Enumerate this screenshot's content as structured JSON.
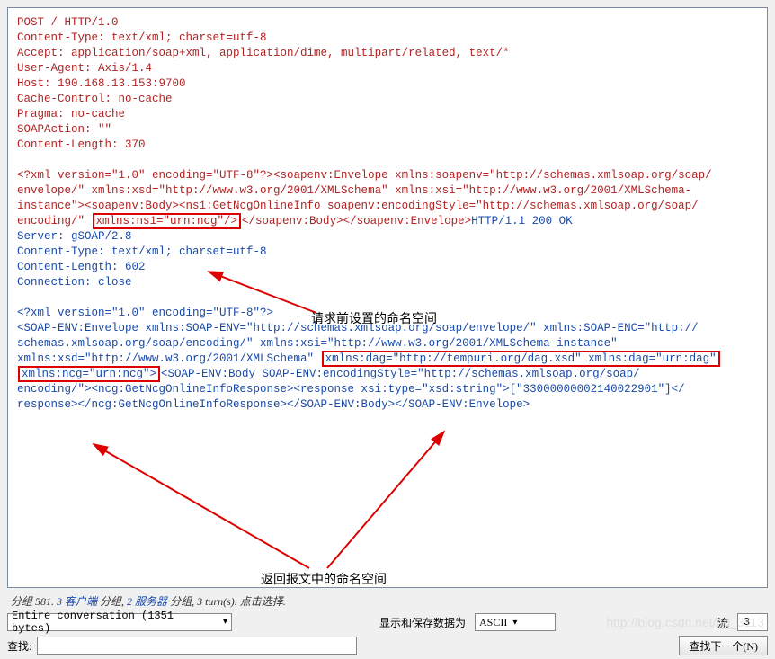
{
  "request": {
    "lines": [
      "POST / HTTP/1.0",
      "Content-Type: text/xml; charset=utf-8",
      "Accept: application/soap+xml, application/dime, multipart/related, text/*",
      "User-Agent: Axis/1.4",
      "Host: 190.168.13.153:9700",
      "Cache-Control: no-cache",
      "Pragma: no-cache",
      "SOAPAction: \"\"",
      "Content-Length: 370"
    ],
    "body_wrap": [
      "<?xml version=\"1.0\" encoding=\"UTF-8\"?><soapenv:Envelope xmlns:soapenv=\"http://schemas.xmlsoap.org/soap/",
      "envelope/\" xmlns:xsd=\"http://www.w3.org/2001/XMLSchema\" xmlns:xsi=\"http://www.w3.org/2001/XMLSchema-",
      "instance\"><soapenv:Body><ns1:GetNcgOnlineInfo soapenv:encodingStyle=\"http://schemas.xmlsoap.org/soap/",
      "encoding/\" "
    ],
    "boxed": "xmlns:ns1=\"urn:ncg\"/>",
    "body_tail": "</soapenv:Body></soapenv:Envelope>"
  },
  "response": {
    "status": "HTTP/1.1 200 OK",
    "headers": [
      "Server: gSOAP/2.8",
      "Content-Type: text/xml; charset=utf-8",
      "Content-Length: 602",
      "Connection: close"
    ],
    "body_pre1": "<?xml version=\"1.0\" encoding=\"UTF-8\"?>",
    "body_pre2a": "<SOAP-ENV:Envelope xmlns:SOAP-ENV=\"http://schemas.xmlsoap.org/soap/envelope/\" xmlns:SOAP-ENC=\"http://",
    "body_pre2b": "schemas.xmlsoap.org/soap/encoding/\" xmlns:xsi=\"http://www.w3.org/2001/XMLSchema-instance\"",
    "body_pre2c": "xmlns:xsd=\"http://www.w3.org/2001/XMLSchema\" ",
    "boxed_top": "xmlns:dag=\"http://tempuri.org/dag.xsd\"  xmlns:dag=\"urn:dag\"",
    "boxed_bot": "xmlns:ncg=\"urn:ncg\">",
    "body_tail": [
      "<SOAP-ENV:Body SOAP-ENV:encodingStyle=\"http://schemas.xmlsoap.org/soap/",
      "encoding/\"><ncg:GetNcgOnlineInfoResponse><response xsi:type=\"xsd:string\">[\"33000000002140022901\"]</",
      "response></ncg:GetNcgOnlineInfoResponse></SOAP-ENV:Body></SOAP-ENV:Envelope>"
    ]
  },
  "annotations": {
    "top": "请求前设置的命名空间",
    "bottom": "返回报文中的命名空间"
  },
  "status_bar": {
    "prefix": "分组 581. ",
    "client": "3 客户端",
    "mid": " 分组, ",
    "server": "2 服务器",
    "tail": " 分组, 3 turn(s). 点击选择."
  },
  "controls": {
    "conv_select": "Entire conversation (1351 bytes)",
    "show_save_label": "显示和保存数据为",
    "encoding_select": "ASCII",
    "stream_label": "流",
    "stream_value": "3"
  },
  "find": {
    "label": "查找:",
    "button": "查找下一个(N)"
  },
  "watermark": "http://blog.csdn.net/qq_3113"
}
